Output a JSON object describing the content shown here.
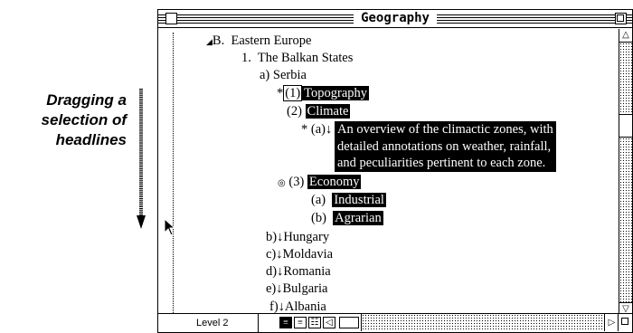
{
  "caption": {
    "line1": "Dragging a",
    "line2": "selection of",
    "line3": "headlines"
  },
  "window": {
    "title": "Geography"
  },
  "outline": {
    "b_label": "B.",
    "b_text": "Eastern Europe",
    "b1_label": "1.",
    "b1_text": "The Balkan States",
    "a_label": "a)",
    "a_text": "Serbia",
    "t_marker": "*",
    "t_label": "(1)",
    "t_text": "Topography",
    "c_label": "(2)",
    "c_text": "Climate",
    "n_marker": "*",
    "n_label": "(a)",
    "n_line1": "An overview of the climactic zones, with",
    "n_line2": "detailed annotations on weather, rainfall,",
    "n_line3": "and peculiarities pertinent to each zone.",
    "e_label": "(3)",
    "e_text": "Economy",
    "ea_label": "(a)",
    "ea_text": "Industrial",
    "eb_label": "(b)",
    "eb_text": "Agrarian",
    "items": [
      "b)↓Hungary",
      "c)↓Moldavia",
      "d)↓Romania",
      "e)↓Bulgaria",
      "f)↓Albania"
    ]
  },
  "status": {
    "level": "Level 2"
  }
}
